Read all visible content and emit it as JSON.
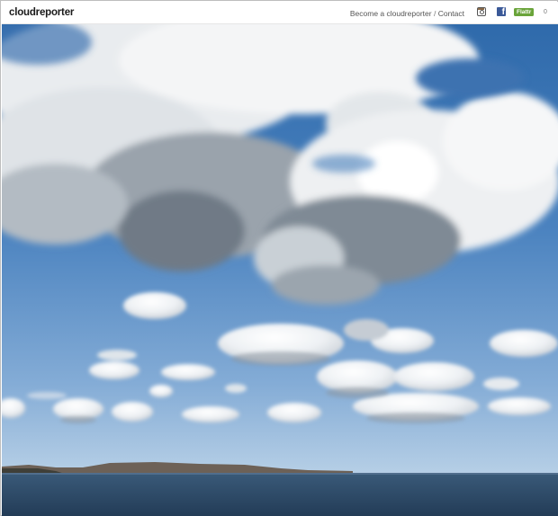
{
  "header": {
    "brand": "cloudreporter",
    "nav": {
      "become_label": "Become a cloudreporter",
      "separator": "/",
      "contact_label": "Contact"
    },
    "social": {
      "instagram_icon": "instagram-icon",
      "facebook_icon": "facebook-icon",
      "facebook_glyph": "f",
      "flattr_label": "Flattr",
      "flattr_count": "0"
    }
  },
  "photo": {
    "subject": "cloud-sky-over-sea-photo",
    "colors": {
      "sky_top": "#3f74b2",
      "sky_bottom": "#a9c6e2",
      "sea": "#2f4f6e",
      "land": "#6d6157",
      "cloud_light": "#ffffff",
      "cloud_shadow": "#6f7a86"
    }
  }
}
